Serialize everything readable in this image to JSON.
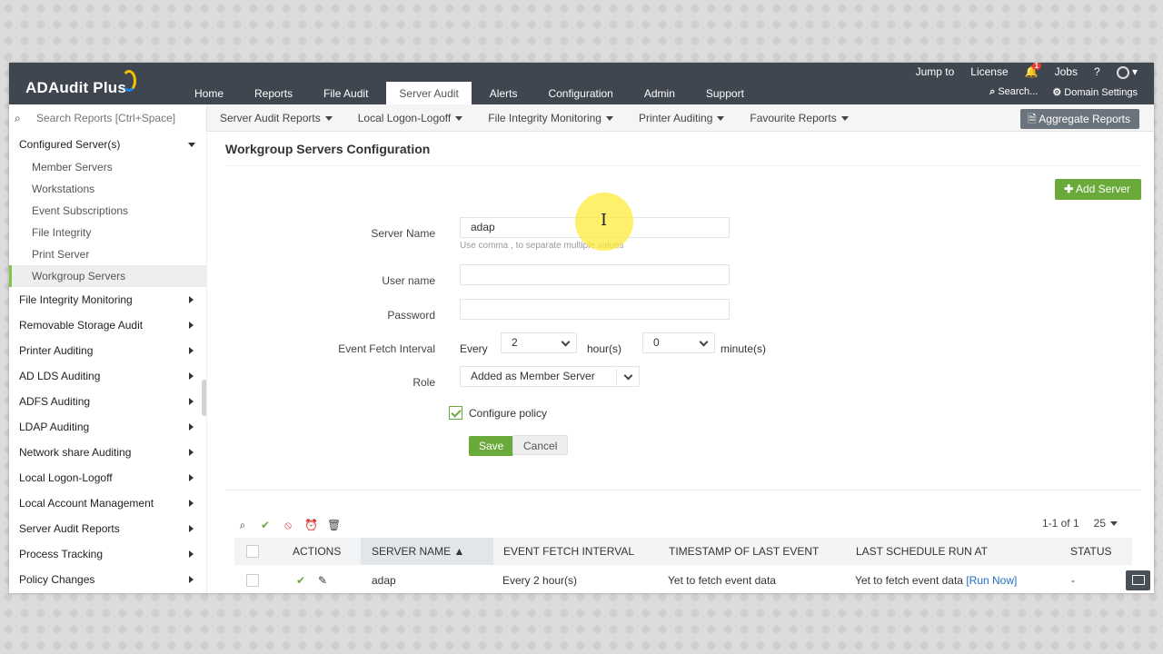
{
  "app": {
    "name": "ADAudit Plus"
  },
  "header": {
    "nav": [
      "Home",
      "Reports",
      "File Audit",
      "Server Audit",
      "Alerts",
      "Configuration",
      "Admin",
      "Support"
    ],
    "active_nav": "Server Audit",
    "top_links": {
      "jump_to": "Jump to",
      "license": "License",
      "notification_count": "1",
      "jobs": "Jobs",
      "help": "?"
    },
    "bottom_links": {
      "search": "Search...",
      "domain_settings": "Domain Settings"
    }
  },
  "subbar": {
    "search_placeholder": "Search Reports [Ctrl+Space]",
    "menus": [
      "Server Audit Reports",
      "Local Logon-Logoff",
      "File Integrity Monitoring",
      "Printer Auditing",
      "Favourite Reports"
    ],
    "aggregate_button": "Aggregate Reports"
  },
  "sidebar": {
    "configured": "Configured Server(s)",
    "sub_items": [
      "Member Servers",
      "Workstations",
      "Event Subscriptions",
      "File Integrity",
      "Print Server",
      "Workgroup Servers"
    ],
    "active_sub": "Workgroup Servers",
    "sections": [
      "File Integrity Monitoring",
      "Removable Storage Audit",
      "Printer Auditing",
      "AD LDS Auditing",
      "ADFS Auditing",
      "LDAP Auditing",
      "Network share Auditing",
      "Local Logon-Logoff",
      "Local Account Management",
      "Server Audit Reports",
      "Process Tracking",
      "Policy Changes"
    ]
  },
  "page": {
    "title": "Workgroup Servers Configuration",
    "add_server": "Add Server"
  },
  "form": {
    "server_name_label": "Server Name",
    "server_name_value": "adap",
    "server_name_hint": "Use comma , to separate multiple values",
    "user_name_label": "User name",
    "password_label": "Password",
    "fetch_label": "Event Fetch Interval",
    "every": "Every",
    "hours_value": "2",
    "hours_unit": "hour(s)",
    "minutes_value": "0",
    "minutes_unit": "minute(s)",
    "role_label": "Role",
    "role_value": "Added as Member Server",
    "configure_policy": "Configure policy",
    "save": "Save",
    "cancel": "Cancel"
  },
  "table": {
    "pager_text": "1-1 of 1",
    "page_size": "25",
    "columns": [
      "Actions",
      "Server Name",
      "Event Fetch Interval",
      "Timestamp of Last Event",
      "Last Schedule Run At",
      "Status"
    ],
    "sorted_column": "Server Name",
    "rows": [
      {
        "server_name": "adap",
        "fetch_interval": "Every 2 hour(s)",
        "last_event": "Yet to fetch event data",
        "last_run": "Yet to fetch event data",
        "run_now": "[Run Now]",
        "status": "-"
      }
    ]
  },
  "colors": {
    "header_bg": "#3f4650",
    "accent_green": "#6aaa3a",
    "active_bar": "#8ac34a"
  }
}
